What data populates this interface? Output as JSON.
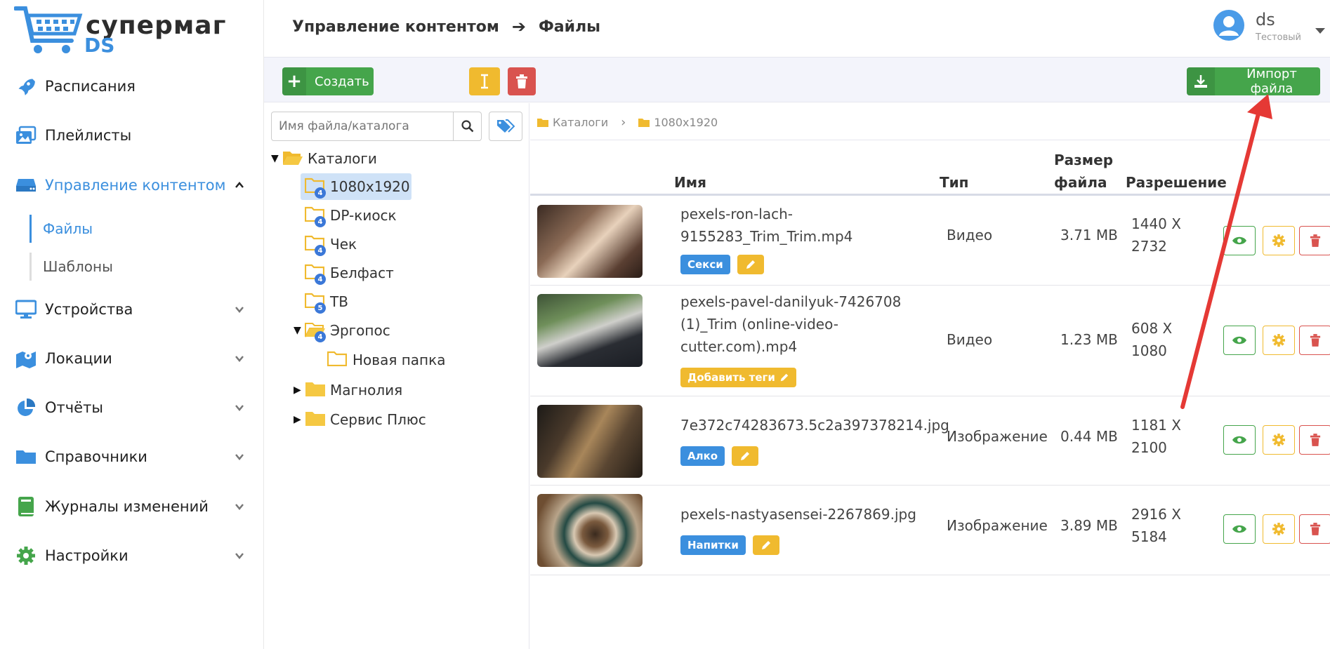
{
  "brand": {
    "name_top": "супермаг",
    "name_bottom": "DS"
  },
  "sidebar": {
    "items": [
      {
        "label": "Расписания",
        "icon": "rocket-icon"
      },
      {
        "label": "Плейлисты",
        "icon": "images-icon"
      },
      {
        "label": "Управление контентом",
        "icon": "hdd-icon",
        "active": true,
        "expanded": true
      },
      {
        "label": "Устройства",
        "icon": "monitor-icon"
      },
      {
        "label": "Локации",
        "icon": "map-icon"
      },
      {
        "label": "Отчёты",
        "icon": "pie-chart-icon"
      },
      {
        "label": "Справочники",
        "icon": "folder-icon"
      },
      {
        "label": "Журналы изменений",
        "icon": "book-icon"
      },
      {
        "label": "Настройки",
        "icon": "gear-icon"
      }
    ],
    "sub_items": [
      {
        "label": "Файлы",
        "active": true
      },
      {
        "label": "Шаблоны"
      }
    ]
  },
  "header": {
    "breadcrumb_parent": "Управление контентом",
    "breadcrumb_current": "Файлы",
    "user_name": "ds",
    "user_role": "Тестовый"
  },
  "toolbar": {
    "create_label": "Создать",
    "import_label": "Импорт файла"
  },
  "tree": {
    "search_placeholder": "Имя файла/каталога",
    "root": "Каталоги",
    "nodes": [
      {
        "label": "1080x1920",
        "count": "4"
      },
      {
        "label": "DP-киоск",
        "count": "4"
      },
      {
        "label": "Чек",
        "count": "4"
      },
      {
        "label": "Белфаст",
        "count": "4"
      },
      {
        "label": "ТВ",
        "count": "5"
      },
      {
        "label": "Эргопос",
        "count": "4"
      },
      {
        "label": "Новая папка"
      },
      {
        "label": "Магнолия"
      },
      {
        "label": "Сервис Плюс"
      }
    ]
  },
  "path": {
    "root": "Каталоги",
    "current": "1080x1920"
  },
  "table": {
    "headers": {
      "name": "Имя",
      "type": "Тип",
      "size_line1": "Размер",
      "size_line2": "файла",
      "resolution": "Разрешение"
    },
    "rows": [
      {
        "name_line1": "pexels-ron-lach-",
        "name_line2": "9155283_Trim_Trim.mp4",
        "type": "Видео",
        "size": "3.71 MB",
        "res_line1": "1440 X",
        "res_line2": "2732",
        "tag": "Секси"
      },
      {
        "name_line1": "pexels-pavel-danilyuk-7426708",
        "name_line2": "(1)_Trim (online-video-",
        "name_line3": "cutter.com).mp4",
        "type": "Видео",
        "size": "1.23 MB",
        "res_line1": "608 X",
        "res_line2": "1080",
        "tag": "Добавить теги"
      },
      {
        "name_line1": "7e372c74283673.5c2a397378214.jpg",
        "type": "Изображение",
        "size": "0.44 MB",
        "res_line1": "1181 X",
        "res_line2": "2100",
        "tag": "Алко"
      },
      {
        "name_line1": "pexels-nastyasensei-2267869.jpg",
        "type": "Изображение",
        "size": "3.89 MB",
        "res_line1": "2916 X",
        "res_line2": "5184",
        "tag": "Напитки"
      }
    ]
  },
  "colors": {
    "accent": "#3b8fde",
    "success": "#45a54b",
    "warning": "#f0ba2f",
    "danger": "#d9534f",
    "annotation": "#e53935"
  }
}
